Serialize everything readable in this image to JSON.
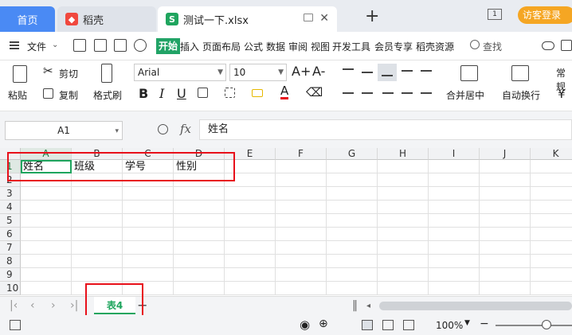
{
  "tabs": {
    "home": "首页",
    "daoke": "稻壳",
    "file": "测试一下.xlsx",
    "new_tab": "+",
    "window_badge": "1",
    "visitor_login": "访客登录"
  },
  "menu": {
    "file": "文件",
    "start": "开始",
    "items": [
      "插入",
      "页面布局",
      "公式",
      "数据",
      "审阅",
      "视图",
      "开发工具",
      "会员专享",
      "稻壳资源"
    ],
    "search": "查找"
  },
  "ribbon": {
    "paste": "粘贴",
    "cut": "剪切",
    "copy": "复制",
    "format_painter": "格式刷",
    "font_name": "Arial",
    "font_size": "10",
    "merge_center": "合并居中",
    "auto_wrap": "自动换行",
    "number_format": "常规",
    "bold": "B",
    "italic": "I",
    "underline": "U",
    "font_color_letter": "A",
    "grow_font": "A+",
    "shrink_font": "A-",
    "currency": "¥"
  },
  "formula_bar": {
    "name_box": "A1",
    "fx": "fx",
    "content": "姓名"
  },
  "grid": {
    "columns": [
      "A",
      "B",
      "C",
      "D",
      "E",
      "F",
      "G",
      "H",
      "I",
      "J",
      "K"
    ],
    "rows": [
      "1",
      "2",
      "3",
      "4",
      "5",
      "6",
      "7",
      "8",
      "9",
      "10"
    ],
    "row1": [
      "姓名",
      "班级",
      "学号",
      "性别"
    ]
  },
  "sheets": {
    "active": "表4"
  },
  "status": {
    "zoom": "100%",
    "zoom_level": 0.67
  }
}
